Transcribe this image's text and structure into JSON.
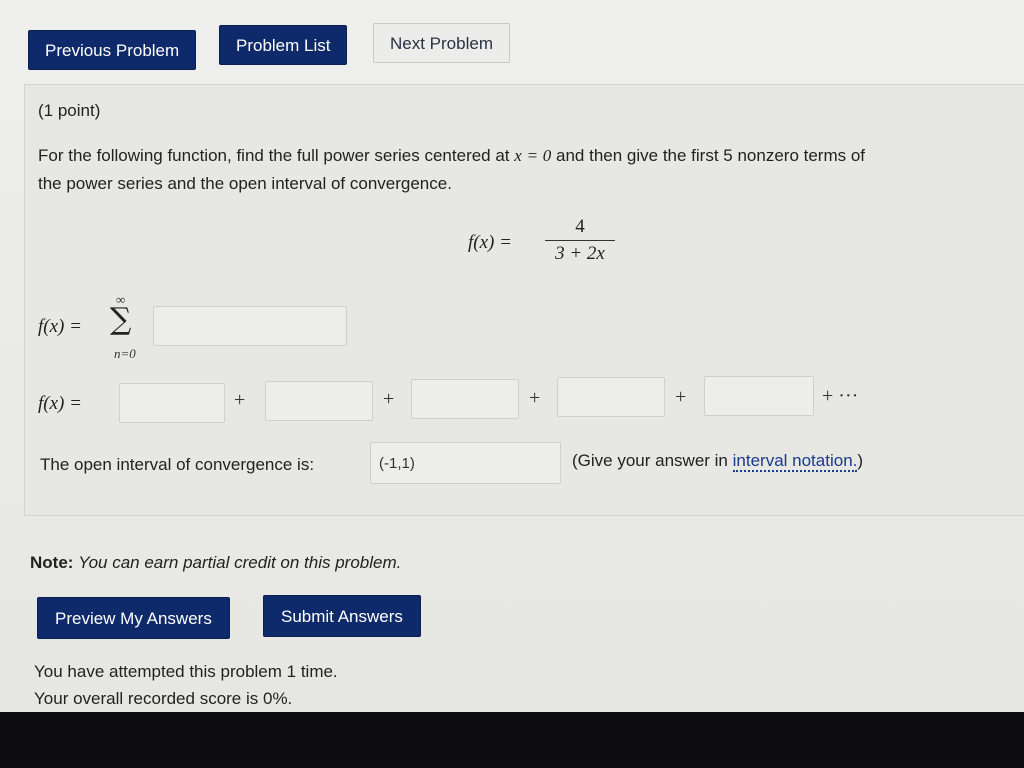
{
  "nav": {
    "previous": "Previous Problem",
    "list": "Problem List",
    "next": "Next Problem"
  },
  "problem": {
    "points": "(1 point)",
    "statement_a": "For the following function, find the full power series centered at",
    "x_var": "x",
    "eq": "=",
    "zero": "0",
    "statement_b": "and then give the first 5 nonzero terms of",
    "statement_line2": "the power series and the open interval of convergence.",
    "function_lhs": "f(x) =",
    "numerator": "4",
    "denominator": "3 + 2x"
  },
  "series": {
    "lhs": "f(x) =",
    "sigma": "∑",
    "upper": "∞",
    "lower": "n=0",
    "value": ""
  },
  "terms": {
    "lhs": "f(x) =",
    "values": [
      "",
      "",
      "",
      "",
      ""
    ],
    "plus": "+",
    "tail": "+ ···"
  },
  "interval": {
    "label": "The open interval of convergence is:",
    "value": "(-1,1)",
    "hint_a": "(Give your answer in ",
    "hint_link": "interval notation.",
    "hint_b": ")"
  },
  "note": {
    "bold": "Note:",
    "italic": "You can earn partial credit on this problem."
  },
  "actions": {
    "preview": "Preview My Answers",
    "submit": "Submit Answers"
  },
  "status": {
    "attempts": "You have attempted this problem 1 time.",
    "score": "Your overall recorded score is 0%."
  },
  "colors": {
    "button_bg": "#0f2a6a",
    "link": "#1a3a8c",
    "page_bg": "#e9e9e7"
  }
}
